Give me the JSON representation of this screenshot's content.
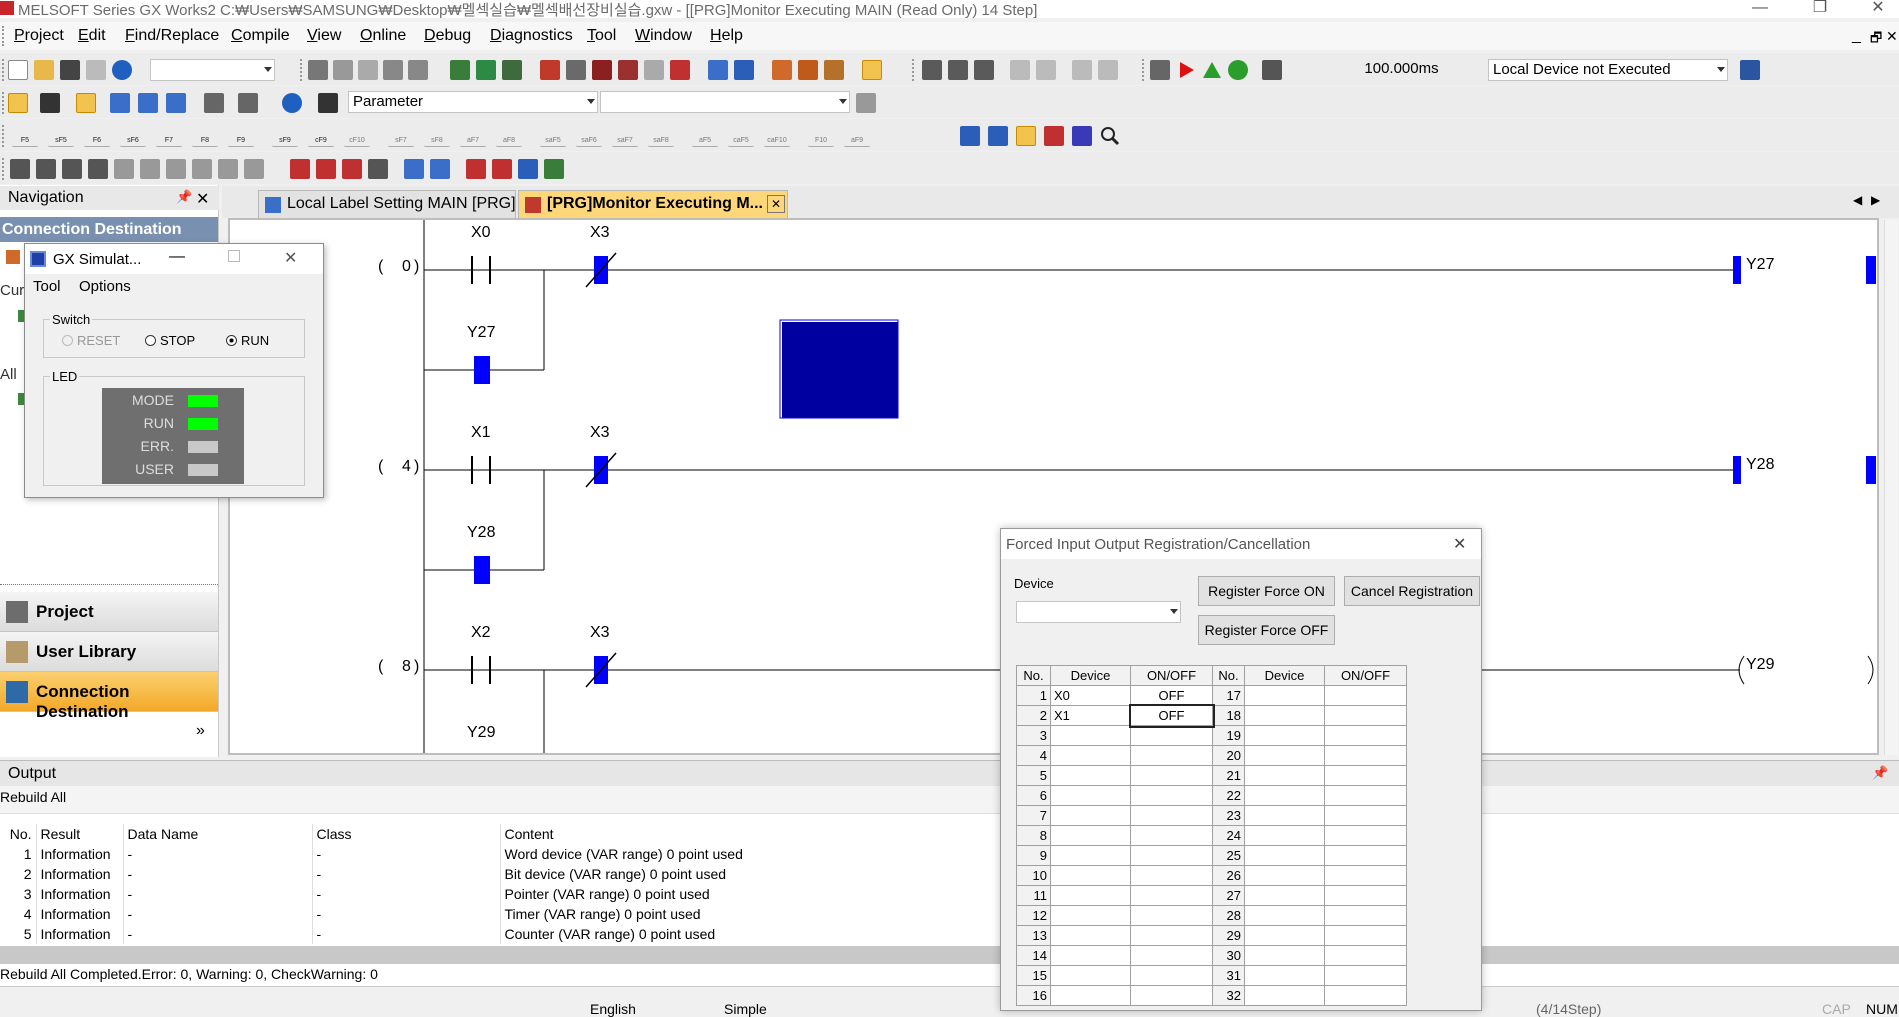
{
  "title_bar": {
    "title": "MELSOFT Series GX Works2 C:₩Users₩SAMSUNG₩Desktop₩멜섹실습₩멜섹배선장비실습.gxw - [[PRG]Monitor Executing MAIN (Read Only) 14 Step]",
    "min": "—",
    "restore": "❐",
    "close": "✕"
  },
  "menu": [
    {
      "u": "P",
      "rest": "roject"
    },
    {
      "u": "E",
      "rest": "dit"
    },
    {
      "u": "F",
      "rest": "ind/Replace"
    },
    {
      "u": "C",
      "rest": "ompile"
    },
    {
      "u": "V",
      "rest": "iew"
    },
    {
      "u": "O",
      "rest": "nline"
    },
    {
      "u": "D",
      "rest": "ebug"
    },
    {
      "u": "D",
      "rest": "iagnostics"
    },
    {
      "u": "T",
      "rest": "ool"
    },
    {
      "u": "W",
      "rest": "indow"
    },
    {
      "u": "H",
      "rest": "elp"
    }
  ],
  "mdi_controls": {
    "min": "_",
    "restore": "🗗",
    "close": "✕"
  },
  "toolbar": {
    "scan_time": "100.000ms",
    "device_status": "Local Device not Executed",
    "parameter_combo": "Parameter",
    "fkeys": [
      "F5",
      "sF5",
      "F6",
      "sF6",
      "F7",
      "F8",
      "F9",
      "sF9",
      "cF9",
      "cF10",
      "sF7",
      "sF8",
      "aF7",
      "aF8",
      "saF5",
      "saF6",
      "saF7",
      "saF8",
      "aF5",
      "caF5",
      "caF10",
      "F10",
      "aF9"
    ]
  },
  "navigation": {
    "title": "Navigation",
    "pin": "📌",
    "close": "✕",
    "connection_destination_header": "Connection Destination",
    "side_label_1": "Cur",
    "side_label_2": "All",
    "sections": [
      {
        "label": "Project",
        "color": "#6d6d6d",
        "active": false
      },
      {
        "label": "User Library",
        "color": "#7a6a4c",
        "active": false
      },
      {
        "label": "Connection Destination",
        "color": "#2f6aa8",
        "active": true
      }
    ],
    "more": "»"
  },
  "tabs": [
    {
      "label": "Local Label Setting MAIN [PRG]",
      "active": false
    },
    {
      "label": "[PRG]Monitor Executing M...",
      "active": true
    }
  ],
  "ladder": {
    "rungs": [
      {
        "step": "0",
        "contact1": "X0",
        "contact2": "X3",
        "branch": "Y27",
        "coil": "Y27"
      },
      {
        "step": "4",
        "contact1": "X1",
        "contact2": "X3",
        "branch": "Y28",
        "coil": "Y28"
      },
      {
        "step": "8",
        "contact1": "X2",
        "contact2": "X3",
        "branch": "Y29",
        "coil": "Y29"
      }
    ],
    "paren_open": "(",
    "paren_close": ")"
  },
  "simulator": {
    "title": "GX Simulat...",
    "menu": [
      "Tool",
      "Options"
    ],
    "switch_label": "Switch",
    "switches": [
      {
        "label": "RESET",
        "selected": false,
        "disabled": true
      },
      {
        "label": "STOP",
        "selected": false,
        "disabled": false
      },
      {
        "label": "RUN",
        "selected": true,
        "disabled": false
      }
    ],
    "led_label": "LED",
    "leds": [
      {
        "label": "MODE",
        "color": "#00ff00"
      },
      {
        "label": "RUN",
        "color": "#00ff00"
      },
      {
        "label": "ERR.",
        "color": "#c8c8c8"
      },
      {
        "label": "USER",
        "color": "#c8c8c8"
      }
    ]
  },
  "force_dialog": {
    "title": "Forced Input Output Registration/Cancellation",
    "device_label": "Device",
    "buttons": {
      "register_on": "Register Force ON",
      "cancel": "Cancel Registration",
      "register_off": "Register Force OFF"
    },
    "columns": [
      "No.",
      "Device",
      "ON/OFF",
      "No.",
      "Device",
      "ON/OFF"
    ],
    "rows": [
      {
        "no": "1",
        "device": "X0",
        "state": "OFF",
        "no2": "17"
      },
      {
        "no": "2",
        "device": "X1",
        "state": "OFF",
        "no2": "18"
      },
      {
        "no": "3",
        "device": "",
        "state": "",
        "no2": "19"
      },
      {
        "no": "4",
        "device": "",
        "state": "",
        "no2": "20"
      },
      {
        "no": "5",
        "device": "",
        "state": "",
        "no2": "21"
      },
      {
        "no": "6",
        "device": "",
        "state": "",
        "no2": "22"
      },
      {
        "no": "7",
        "device": "",
        "state": "",
        "no2": "23"
      },
      {
        "no": "8",
        "device": "",
        "state": "",
        "no2": "24"
      },
      {
        "no": "9",
        "device": "",
        "state": "",
        "no2": "25"
      },
      {
        "no": "10",
        "device": "",
        "state": "",
        "no2": "26"
      },
      {
        "no": "11",
        "device": "",
        "state": "",
        "no2": "27"
      },
      {
        "no": "12",
        "device": "",
        "state": "",
        "no2": "28"
      },
      {
        "no": "13",
        "device": "",
        "state": "",
        "no2": "29"
      },
      {
        "no": "14",
        "device": "",
        "state": "",
        "no2": "30"
      },
      {
        "no": "15",
        "device": "",
        "state": "",
        "no2": "31"
      },
      {
        "no": "16",
        "device": "",
        "state": "",
        "no2": "32"
      }
    ]
  },
  "output": {
    "title": "Output",
    "subtitle": "Rebuild All",
    "columns": [
      "No.",
      "Result",
      "Data Name",
      "Class",
      "Content"
    ],
    "rows": [
      {
        "no": "1",
        "result": "Information",
        "data": "-",
        "class": "-",
        "content": "Word device (VAR range) 0 point used"
      },
      {
        "no": "2",
        "result": "Information",
        "data": "-",
        "class": "-",
        "content": "Bit device (VAR range) 0 point used"
      },
      {
        "no": "3",
        "result": "Information",
        "data": "-",
        "class": "-",
        "content": "Pointer (VAR range) 0 point used"
      },
      {
        "no": "4",
        "result": "Information",
        "data": "-",
        "class": "-",
        "content": "Timer (VAR range) 0 point used"
      },
      {
        "no": "5",
        "result": "Information",
        "data": "-",
        "class": "-",
        "content": "Counter (VAR range) 0 point used"
      }
    ],
    "summary": "Rebuild All Completed.Error: 0, Warning: 0, CheckWarning: 0"
  },
  "statusbar": {
    "lang": "English",
    "mode": "Simple",
    "steps": "(4/14Step)",
    "caps": "CAP",
    "num": "NUM"
  },
  "colors": {
    "ladder_blue": "#0000ff",
    "dark_blue": "#0000a0",
    "led_on": "#00ff00",
    "active_section": "#f7b733"
  }
}
